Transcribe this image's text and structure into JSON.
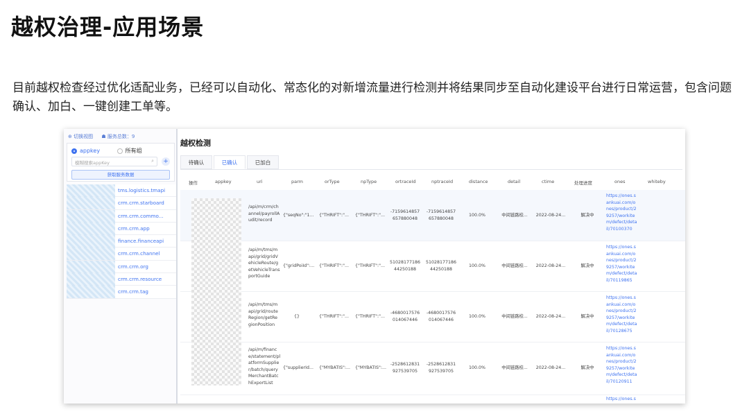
{
  "slide": {
    "title": "越权治理-应用场景",
    "description": "目前越权检查经过优化适配业务，已经可以自动化、常态化的对新增流量进行检测并将结果同步至自动化建设平台进行日常运营，包含问题确认、加白、一键创建工单等。"
  },
  "sidebar": {
    "switch_view": "⊕ 切换视图",
    "service_total": "☗ 服务总数：9",
    "radio_appkey": "appkey",
    "radio_all": "所有组",
    "search_placeholder": "模糊搜索appKey",
    "plus": "+",
    "fetch_button": "获取服务数据",
    "items": [
      "tms.logistics.tmapi",
      "crm.crm.starboard",
      "crm.crm.commo...",
      "crm.crm.app",
      "finance.financeapi",
      "crm.crm.channel",
      "crm.crm.org",
      "crm.crm.resource",
      "crm.crm.tag"
    ]
  },
  "main": {
    "title": "越权检测",
    "tabs": [
      "待确认",
      "已确认",
      "已加白"
    ],
    "active_tab": 1,
    "columns": [
      "操作",
      "appkey",
      "uri",
      "parm",
      "orType",
      "npType",
      "ortraceId",
      "nptraceId",
      "distance",
      "detail",
      "ctime",
      "处理进度",
      "ones",
      "whiteby"
    ],
    "rows": [
      {
        "uri": "/api/m/crm/ch annel/payrollA udit/record",
        "parm": "{\"seqNo\":\"1...",
        "orType": "{\"THRIFT\":\"...",
        "npType": "{\"THRIFT\":\"...",
        "ortraceId": "-7159614857 657880048",
        "nptraceId": "-7159614857 657880048",
        "distance": "100.0%",
        "detail": "中间链路校...",
        "ctime": "2022-08-24...",
        "status": "解决中",
        "ones": "https://ones.s ankuai.com/o nes/product/2 9257/workite m/defect/deta il/70100370"
      },
      {
        "uri": "/api/m/tms/m api/grid/gridV ehicleRoute/g etVehicleTrans portGuide",
        "parm": "{\"gridPoiId\":...",
        "orType": "{\"THRIFT\":\"...",
        "npType": "{\"THRIFT\":\"...",
        "ortraceId": "51028177186 44250188",
        "nptraceId": "51028177186 44250188",
        "distance": "100.0%",
        "detail": "中间链路校...",
        "ctime": "2022-08-24...",
        "status": "解决中",
        "ones": "https://ones.s ankuai.com/o nes/product/2 9257/workite m/defect/deta il/70119865"
      },
      {
        "uri": "/api/m/tms/m api/grid/route Region/getRe gionPosition",
        "parm": "{}",
        "orType": "{\"THRIFT\":\"...",
        "npType": "{\"THRIFT\":\"...",
        "ortraceId": "-4680017576 014067446",
        "nptraceId": "-4680017576 014067446",
        "distance": "100.0%",
        "detail": "中间链路校...",
        "ctime": "2022-08-24...",
        "status": "解决中",
        "ones": "https://ones.s ankuai.com/o nes/product/2 9257/workite m/defect/deta il/70128675"
      },
      {
        "uri": "/api/m/financ e/statement/pl atformSupplie r/batch/query MerchantBatc hExportList",
        "parm": "{\"supplierId...",
        "orType": "{\"MYBATIS\":...",
        "npType": "{\"MYBATIS\":...",
        "ortraceId": "-2528612831 927539705",
        "nptraceId": "-2528612831 927539705",
        "distance": "100.0%",
        "detail": "中间链路校...",
        "ctime": "2022-08-24...",
        "status": "解决中",
        "ones": "https://ones.s ankuai.com/o nes/product/2 9257/workite m/defect/deta il/70120911"
      }
    ],
    "partial_row_ones": "https://ones.s"
  }
}
